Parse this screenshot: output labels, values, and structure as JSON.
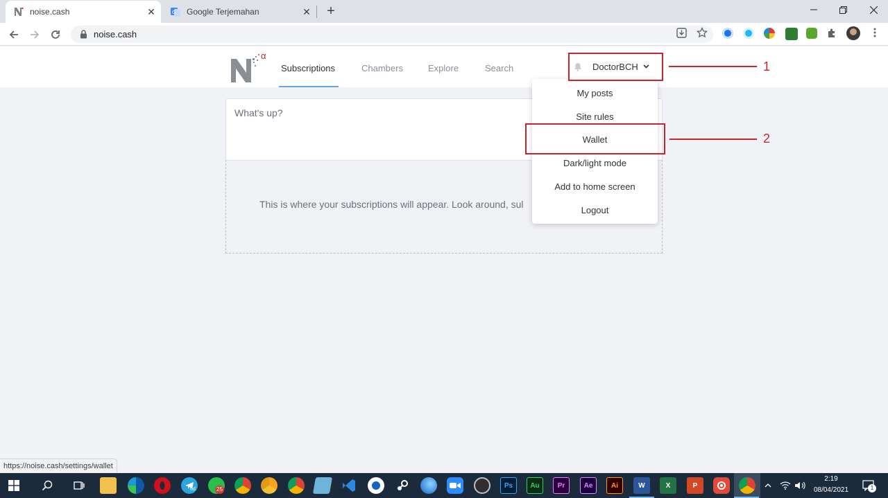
{
  "browser": {
    "tabs": [
      {
        "title": "noise.cash",
        "favicon": "noise-cash-favicon",
        "active": true
      },
      {
        "title": "Google Terjemahan",
        "favicon": "google-translate-favicon",
        "active": false
      }
    ],
    "new_tab_symbol": "+",
    "close_symbol": "✕",
    "url": "noise.cash",
    "status_url": "https://noise.cash/settings/wallet"
  },
  "site": {
    "logo_alpha": "α",
    "nav": [
      {
        "label": "Subscriptions",
        "active": true
      },
      {
        "label": "Chambers",
        "active": false
      },
      {
        "label": "Explore",
        "active": false
      },
      {
        "label": "Search",
        "active": false
      }
    ],
    "username": "DoctorBCH",
    "composer_placeholder": "What's up?",
    "empty_message": "This is where your subscriptions will appear. Look around, sul",
    "user_dropdown": [
      "My posts",
      "Site rules",
      "Wallet",
      "Dark/light mode",
      "Add to home screen",
      "Logout"
    ]
  },
  "annotations": [
    {
      "number": "1",
      "target": "user-menu"
    },
    {
      "number": "2",
      "target": "Wallet"
    }
  ],
  "taskbar": {
    "time": "2:19",
    "date": "08/04/2021",
    "badges": {
      "whatsapp": "25",
      "telegram": "od",
      "notifications": "1"
    },
    "apps": [
      "start",
      "search",
      "task-view",
      "file-explorer",
      "edge",
      "opera",
      "telegram",
      "whatsapp",
      "chrome",
      "chrome-canary",
      "chrome-2",
      "notepad",
      "vscode",
      "wps",
      "steam",
      "edge-dev",
      "zoom",
      "obs",
      "photoshop",
      "audition",
      "premiere",
      "after-effects",
      "illustrator",
      "word",
      "excel",
      "powerpoint",
      "screen-recorder",
      "chrome-active"
    ],
    "app_labels": {
      "photoshop": "Ps",
      "audition": "Au",
      "premiere": "Pr",
      "after_effects": "Ae",
      "illustrator": "Ai",
      "word": "W",
      "excel": "X",
      "powerpoint": "P"
    }
  },
  "colors": {
    "annotation_red": "#c4262e",
    "nav_underline": "#6aa4dc",
    "page_bg": "#f1f2f5",
    "taskbar_bg": "#1c2b3c"
  }
}
